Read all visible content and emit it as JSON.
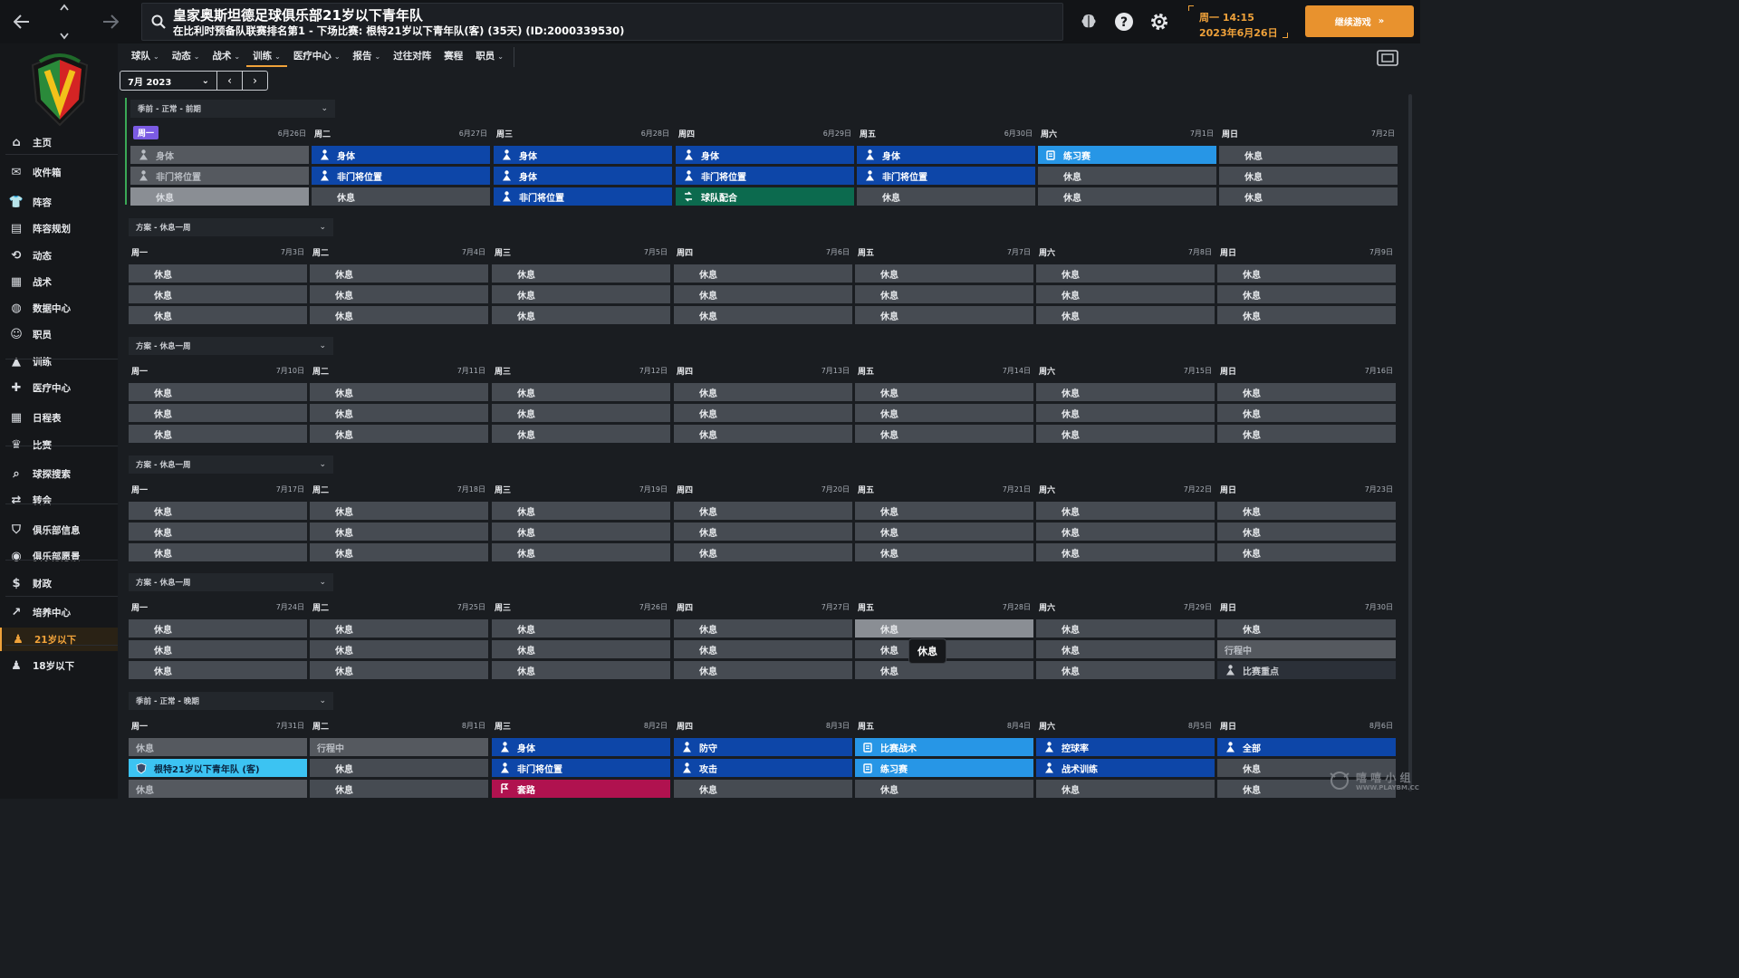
{
  "header": {
    "club_name": "皇家奥斯坦德足球俱乐部21岁以下青年队",
    "subtitle": "在比利时预备队联赛排名第1 - 下场比赛: 根特21岁以下青年队(客) (35天) (ID:2000339530)",
    "day_time": "周一 14:15",
    "date": "2023年6月26日",
    "continue_label": "继续游戏"
  },
  "sidebar": {
    "items": [
      {
        "label": "主页",
        "icon": "home-icon"
      },
      {
        "label": "收件箱",
        "icon": "inbox-icon"
      },
      {
        "label": "阵容",
        "icon": "shirt-icon"
      },
      {
        "label": "阵容规划",
        "icon": "clipboard-icon"
      },
      {
        "label": "动态",
        "icon": "dynamics-icon"
      },
      {
        "label": "战术",
        "icon": "tactics-icon"
      },
      {
        "label": "数据中心",
        "icon": "data-icon"
      },
      {
        "label": "职员",
        "icon": "staff-icon"
      },
      {
        "label": "训练",
        "icon": "training-icon"
      },
      {
        "label": "医疗中心",
        "icon": "medical-icon"
      },
      {
        "label": "日程表",
        "icon": "calendar-icon"
      },
      {
        "label": "比赛",
        "icon": "trophy-icon"
      },
      {
        "label": "球探搜索",
        "icon": "scout-icon"
      },
      {
        "label": "转会",
        "icon": "transfer-icon"
      },
      {
        "label": "俱乐部信息",
        "icon": "shield-icon"
      },
      {
        "label": "俱乐部愿景",
        "icon": "vision-icon"
      },
      {
        "label": "财政",
        "icon": "finance-icon"
      },
      {
        "label": "培养中心",
        "icon": "development-icon"
      },
      {
        "label": "21岁以下",
        "icon": "u21-icon"
      },
      {
        "label": "18岁以下",
        "icon": "u18-icon"
      }
    ]
  },
  "tabs": [
    {
      "label": "球队",
      "chev": "⌄"
    },
    {
      "label": "动态",
      "chev": "⌄"
    },
    {
      "label": "战术",
      "chev": "⌄"
    },
    {
      "label": "训练",
      "chev": "⌄"
    },
    {
      "label": "医疗中心",
      "chev": "⌄"
    },
    {
      "label": "报告",
      "chev": "⌄"
    },
    {
      "label": "过往对阵",
      "chev": ""
    },
    {
      "label": "赛程",
      "chev": ""
    },
    {
      "label": "职员",
      "chev": "⌄"
    }
  ],
  "month_picker": {
    "value": "7月 2023"
  },
  "tooltip": "休息",
  "watermark": {
    "main": "嘻 嘻 小 组",
    "sub": "WWW.PLAYBM.CC"
  },
  "weeks": [
    {
      "name": "季前 - 正常 - 前期",
      "days": [
        {
          "day": "周一",
          "date": "6月26日",
          "today": true,
          "slots": [
            {
              "label": "身体",
              "type": "past",
              "icon": "person"
            },
            {
              "label": "非门将位置",
              "type": "past",
              "icon": "person"
            },
            {
              "label": "休息",
              "type": "pastlight",
              "icon": ""
            }
          ]
        },
        {
          "day": "周二",
          "date": "6月27日",
          "slots": [
            {
              "label": "身体",
              "type": "blue",
              "icon": "person"
            },
            {
              "label": "非门将位置",
              "type": "blue",
              "icon": "person"
            },
            {
              "label": "休息",
              "type": "rest",
              "icon": ""
            }
          ]
        },
        {
          "day": "周三",
          "date": "6月28日",
          "slots": [
            {
              "label": "身体",
              "type": "blue",
              "icon": "person"
            },
            {
              "label": "身体",
              "type": "blue",
              "icon": "person"
            },
            {
              "label": "非门将位置",
              "type": "blue",
              "icon": "person"
            }
          ]
        },
        {
          "day": "周四",
          "date": "6月29日",
          "slots": [
            {
              "label": "身体",
              "type": "blue",
              "icon": "person"
            },
            {
              "label": "非门将位置",
              "type": "blue",
              "icon": "person"
            },
            {
              "label": "球队配合",
              "type": "green",
              "icon": "team"
            }
          ]
        },
        {
          "day": "周五",
          "date": "6月30日",
          "slots": [
            {
              "label": "身体",
              "type": "blue",
              "icon": "person"
            },
            {
              "label": "非门将位置",
              "type": "blue",
              "icon": "person"
            },
            {
              "label": "休息",
              "type": "rest",
              "icon": ""
            }
          ]
        },
        {
          "day": "周六",
          "date": "7月1日",
          "slots": [
            {
              "label": "练习赛",
              "type": "lightblue",
              "icon": "match"
            },
            {
              "label": "休息",
              "type": "rest",
              "icon": ""
            },
            {
              "label": "休息",
              "type": "rest",
              "icon": ""
            }
          ]
        },
        {
          "day": "周日",
          "date": "7月2日",
          "slots": [
            {
              "label": "休息",
              "type": "rest",
              "icon": ""
            },
            {
              "label": "休息",
              "type": "rest",
              "icon": ""
            },
            {
              "label": "休息",
              "type": "rest",
              "icon": ""
            }
          ]
        }
      ]
    },
    {
      "name": "方案 - 休息一周",
      "days": [
        {
          "day": "周一",
          "date": "7月3日",
          "slots": [
            {
              "label": "休息",
              "type": "rest"
            },
            {
              "label": "休息",
              "type": "rest"
            },
            {
              "label": "休息",
              "type": "rest"
            }
          ]
        },
        {
          "day": "周二",
          "date": "7月4日",
          "slots": [
            {
              "label": "休息",
              "type": "rest"
            },
            {
              "label": "休息",
              "type": "rest"
            },
            {
              "label": "休息",
              "type": "rest"
            }
          ]
        },
        {
          "day": "周三",
          "date": "7月5日",
          "slots": [
            {
              "label": "休息",
              "type": "rest"
            },
            {
              "label": "休息",
              "type": "rest"
            },
            {
              "label": "休息",
              "type": "rest"
            }
          ]
        },
        {
          "day": "周四",
          "date": "7月6日",
          "slots": [
            {
              "label": "休息",
              "type": "rest"
            },
            {
              "label": "休息",
              "type": "rest"
            },
            {
              "label": "休息",
              "type": "rest"
            }
          ]
        },
        {
          "day": "周五",
          "date": "7月7日",
          "slots": [
            {
              "label": "休息",
              "type": "rest"
            },
            {
              "label": "休息",
              "type": "rest"
            },
            {
              "label": "休息",
              "type": "rest"
            }
          ]
        },
        {
          "day": "周六",
          "date": "7月8日",
          "slots": [
            {
              "label": "休息",
              "type": "rest"
            },
            {
              "label": "休息",
              "type": "rest"
            },
            {
              "label": "休息",
              "type": "rest"
            }
          ]
        },
        {
          "day": "周日",
          "date": "7月9日",
          "slots": [
            {
              "label": "休息",
              "type": "rest"
            },
            {
              "label": "休息",
              "type": "rest"
            },
            {
              "label": "休息",
              "type": "rest"
            }
          ]
        }
      ]
    },
    {
      "name": "方案 - 休息一周",
      "days": [
        {
          "day": "周一",
          "date": "7月10日",
          "slots": [
            {
              "label": "休息",
              "type": "rest"
            },
            {
              "label": "休息",
              "type": "rest"
            },
            {
              "label": "休息",
              "type": "rest"
            }
          ]
        },
        {
          "day": "周二",
          "date": "7月11日",
          "slots": [
            {
              "label": "休息",
              "type": "rest"
            },
            {
              "label": "休息",
              "type": "rest"
            },
            {
              "label": "休息",
              "type": "rest"
            }
          ]
        },
        {
          "day": "周三",
          "date": "7月12日",
          "slots": [
            {
              "label": "休息",
              "type": "rest"
            },
            {
              "label": "休息",
              "type": "rest"
            },
            {
              "label": "休息",
              "type": "rest"
            }
          ]
        },
        {
          "day": "周四",
          "date": "7月13日",
          "slots": [
            {
              "label": "休息",
              "type": "rest"
            },
            {
              "label": "休息",
              "type": "rest"
            },
            {
              "label": "休息",
              "type": "rest"
            }
          ]
        },
        {
          "day": "周五",
          "date": "7月14日",
          "slots": [
            {
              "label": "休息",
              "type": "rest"
            },
            {
              "label": "休息",
              "type": "rest"
            },
            {
              "label": "休息",
              "type": "rest"
            }
          ]
        },
        {
          "day": "周六",
          "date": "7月15日",
          "slots": [
            {
              "label": "休息",
              "type": "rest"
            },
            {
              "label": "休息",
              "type": "rest"
            },
            {
              "label": "休息",
              "type": "rest"
            }
          ]
        },
        {
          "day": "周日",
          "date": "7月16日",
          "slots": [
            {
              "label": "休息",
              "type": "rest"
            },
            {
              "label": "休息",
              "type": "rest"
            },
            {
              "label": "休息",
              "type": "rest"
            }
          ]
        }
      ]
    },
    {
      "name": "方案 - 休息一周",
      "days": [
        {
          "day": "周一",
          "date": "7月17日",
          "slots": [
            {
              "label": "休息",
              "type": "rest"
            },
            {
              "label": "休息",
              "type": "rest"
            },
            {
              "label": "休息",
              "type": "rest"
            }
          ]
        },
        {
          "day": "周二",
          "date": "7月18日",
          "slots": [
            {
              "label": "休息",
              "type": "rest"
            },
            {
              "label": "休息",
              "type": "rest"
            },
            {
              "label": "休息",
              "type": "rest"
            }
          ]
        },
        {
          "day": "周三",
          "date": "7月19日",
          "slots": [
            {
              "label": "休息",
              "type": "rest"
            },
            {
              "label": "休息",
              "type": "rest"
            },
            {
              "label": "休息",
              "type": "rest"
            }
          ]
        },
        {
          "day": "周四",
          "date": "7月20日",
          "slots": [
            {
              "label": "休息",
              "type": "rest"
            },
            {
              "label": "休息",
              "type": "rest"
            },
            {
              "label": "休息",
              "type": "rest"
            }
          ]
        },
        {
          "day": "周五",
          "date": "7月21日",
          "slots": [
            {
              "label": "休息",
              "type": "rest"
            },
            {
              "label": "休息",
              "type": "rest"
            },
            {
              "label": "休息",
              "type": "rest"
            }
          ]
        },
        {
          "day": "周六",
          "date": "7月22日",
          "slots": [
            {
              "label": "休息",
              "type": "rest"
            },
            {
              "label": "休息",
              "type": "rest"
            },
            {
              "label": "休息",
              "type": "rest"
            }
          ]
        },
        {
          "day": "周日",
          "date": "7月23日",
          "slots": [
            {
              "label": "休息",
              "type": "rest"
            },
            {
              "label": "休息",
              "type": "rest"
            },
            {
              "label": "休息",
              "type": "rest"
            }
          ]
        }
      ]
    },
    {
      "name": "方案 - 休息一周",
      "days": [
        {
          "day": "周一",
          "date": "7月24日",
          "slots": [
            {
              "label": "休息",
              "type": "rest"
            },
            {
              "label": "休息",
              "type": "rest"
            },
            {
              "label": "休息",
              "type": "rest"
            }
          ]
        },
        {
          "day": "周二",
          "date": "7月25日",
          "slots": [
            {
              "label": "休息",
              "type": "rest"
            },
            {
              "label": "休息",
              "type": "rest"
            },
            {
              "label": "休息",
              "type": "rest"
            }
          ]
        },
        {
          "day": "周三",
          "date": "7月26日",
          "slots": [
            {
              "label": "休息",
              "type": "rest"
            },
            {
              "label": "休息",
              "type": "rest"
            },
            {
              "label": "休息",
              "type": "rest"
            }
          ]
        },
        {
          "day": "周四",
          "date": "7月27日",
          "slots": [
            {
              "label": "休息",
              "type": "rest"
            },
            {
              "label": "休息",
              "type": "rest"
            },
            {
              "label": "休息",
              "type": "rest"
            }
          ]
        },
        {
          "day": "周五",
          "date": "7月28日",
          "slots": [
            {
              "label": "休息",
              "type": "hover"
            },
            {
              "label": "休息",
              "type": "rest"
            },
            {
              "label": "休息",
              "type": "rest"
            }
          ]
        },
        {
          "day": "周六",
          "date": "7月29日",
          "slots": [
            {
              "label": "休息",
              "type": "rest"
            },
            {
              "label": "休息",
              "type": "rest"
            },
            {
              "label": "休息",
              "type": "rest"
            }
          ]
        },
        {
          "day": "周日",
          "date": "7月30日",
          "slots": [
            {
              "label": "休息",
              "type": "rest"
            },
            {
              "label": "行程中",
              "type": "past"
            },
            {
              "label": "比赛重点",
              "type": "dark",
              "icon": "person"
            }
          ]
        }
      ]
    },
    {
      "name": "季前 - 正常 - 晚期",
      "days": [
        {
          "day": "周一",
          "date": "7月31日",
          "slots": [
            {
              "label": "休息",
              "type": "past"
            },
            {
              "label": "根特21岁以下青年队 (客)",
              "type": "match",
              "icon": "crest"
            },
            {
              "label": "休息",
              "type": "past"
            }
          ]
        },
        {
          "day": "周二",
          "date": "8月1日",
          "slots": [
            {
              "label": "行程中",
              "type": "past"
            },
            {
              "label": "休息",
              "type": "rest"
            },
            {
              "label": "休息",
              "type": "rest"
            }
          ]
        },
        {
          "day": "周三",
          "date": "8月2日",
          "slots": [
            {
              "label": "身体",
              "type": "blue",
              "icon": "person"
            },
            {
              "label": "非门将位置",
              "type": "blue",
              "icon": "person"
            },
            {
              "label": "套路",
              "type": "pink",
              "icon": "flag"
            }
          ]
        },
        {
          "day": "周四",
          "date": "8月3日",
          "slots": [
            {
              "label": "防守",
              "type": "blue",
              "icon": "person"
            },
            {
              "label": "攻击",
              "type": "blue",
              "icon": "person"
            },
            {
              "label": "休息",
              "type": "rest"
            }
          ]
        },
        {
          "day": "周五",
          "date": "8月4日",
          "slots": [
            {
              "label": "比赛战术",
              "type": "lightblue",
              "icon": "match"
            },
            {
              "label": "练习赛",
              "type": "lightblue",
              "icon": "match"
            },
            {
              "label": "休息",
              "type": "rest"
            }
          ]
        },
        {
          "day": "周六",
          "date": "8月5日",
          "slots": [
            {
              "label": "控球率",
              "type": "blue",
              "icon": "person"
            },
            {
              "label": "战术训练",
              "type": "blue",
              "icon": "person"
            },
            {
              "label": "休息",
              "type": "rest"
            }
          ]
        },
        {
          "day": "周日",
          "date": "8月6日",
          "slots": [
            {
              "label": "全部",
              "type": "blue",
              "icon": "person"
            },
            {
              "label": "休息",
              "type": "rest"
            },
            {
              "label": "休息",
              "type": "rest"
            }
          ]
        }
      ]
    }
  ]
}
